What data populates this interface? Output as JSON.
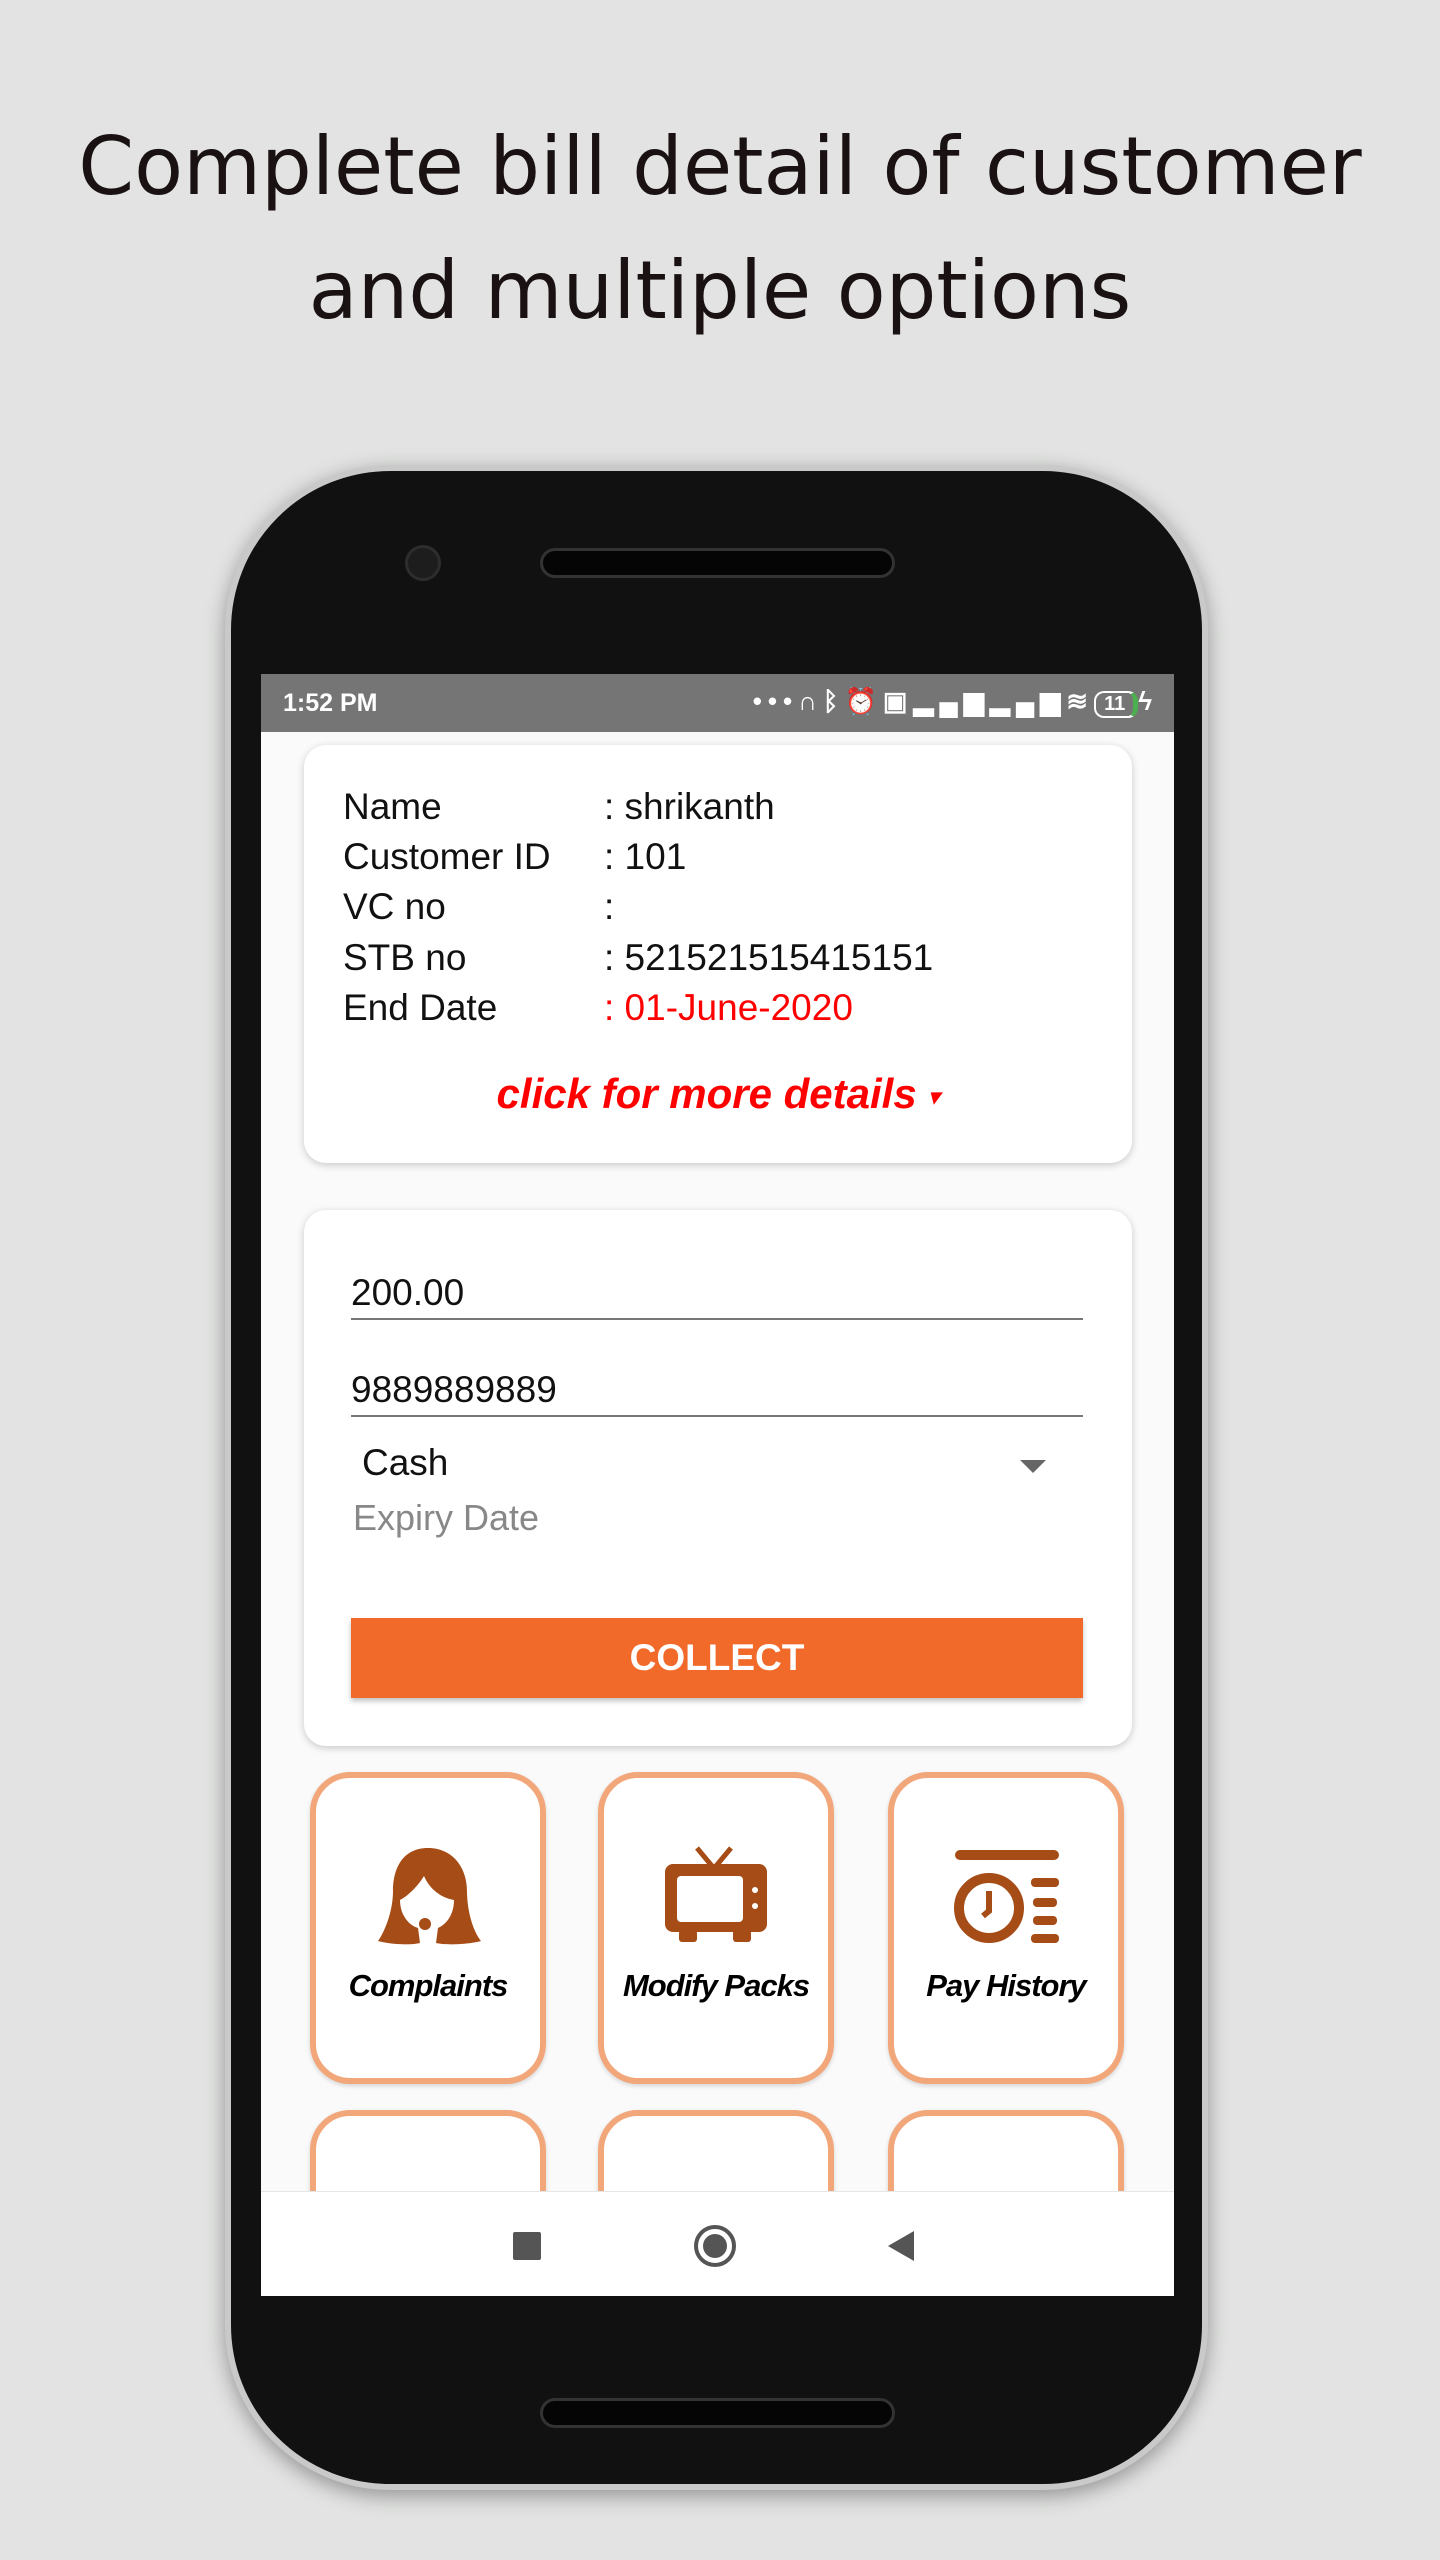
{
  "headline": {
    "line1": "Complete bill detail of customer",
    "line2": "and multiple options"
  },
  "status_bar": {
    "time": "1:52 PM",
    "battery": "11",
    "icons": [
      "more-dots-icon",
      "headset-icon",
      "bluetooth-icon",
      "alarm-icon",
      "volte-icon",
      "signal-4g-icon",
      "signal-icon",
      "wifi-icon",
      "battery-icon",
      "charging-icon"
    ]
  },
  "customer": {
    "rows": [
      {
        "label": "Name",
        "value": ": shrikanth"
      },
      {
        "label": "Customer ID",
        "value": ": 101"
      },
      {
        "label": "VC no",
        "value": ":"
      },
      {
        "label": "STB no",
        "value": ": 521521515415151"
      },
      {
        "label": "End Date",
        "value": ": 01-June-2020"
      }
    ],
    "end_date_color": "#ff0000",
    "more_link": "click for more details"
  },
  "payment": {
    "amount": "200.00",
    "phone": "9889889889",
    "mode": "Cash",
    "expiry_placeholder": "Expiry Date",
    "collect_label": "COLLECT",
    "accent": "#f26a2a"
  },
  "tiles": [
    {
      "label": "Complaints",
      "icon": "support-agent-icon"
    },
    {
      "label": "Modify Packs",
      "icon": "tv-icon"
    },
    {
      "label": "Pay History",
      "icon": "pay-history-icon"
    }
  ],
  "icon_color": "#a64c16",
  "tile_border": "#f2a77a"
}
